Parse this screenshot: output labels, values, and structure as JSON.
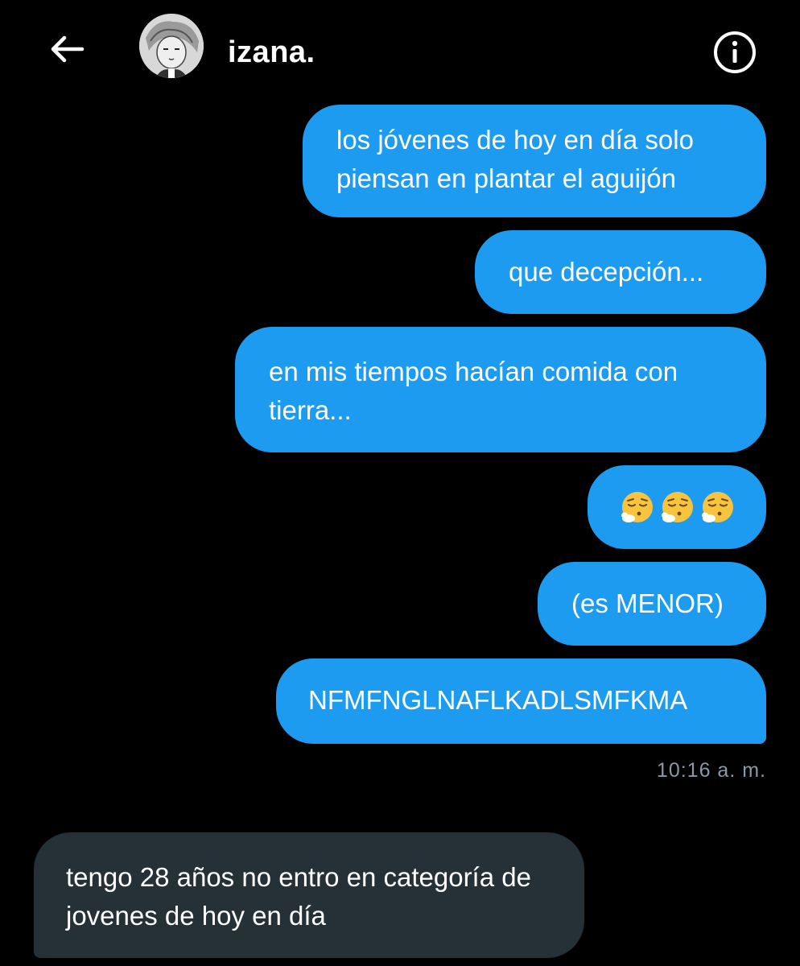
{
  "header": {
    "back_icon": "arrow-left-icon",
    "contact_name": "izana.",
    "info_icon": "info-icon"
  },
  "messages": [
    {
      "direction": "sent",
      "text": "los jóvenes de hoy en día solo piensan en plantar el aguijón"
    },
    {
      "direction": "sent",
      "text": "que decepción..."
    },
    {
      "direction": "sent",
      "text": "en mis tiempos hacían comida con tierra..."
    },
    {
      "direction": "sent",
      "emoji": [
        "😮‍💨",
        "😮‍💨",
        "😮‍💨"
      ],
      "emoji_name": "face-exhaling"
    },
    {
      "direction": "sent",
      "text": "(es MENOR)"
    },
    {
      "direction": "sent",
      "text": "NFMFNGLNAFLKADLSMFKMA"
    },
    {
      "direction": "received",
      "text": "tengo 28 años no entro en categoría de jovenes de hoy en día"
    }
  ],
  "timestamp": "10:16 a. m.",
  "colors": {
    "background": "#000000",
    "sent_bubble": "#1d9bf0",
    "received_bubble": "#263037",
    "timestamp": "#8b98a5"
  }
}
